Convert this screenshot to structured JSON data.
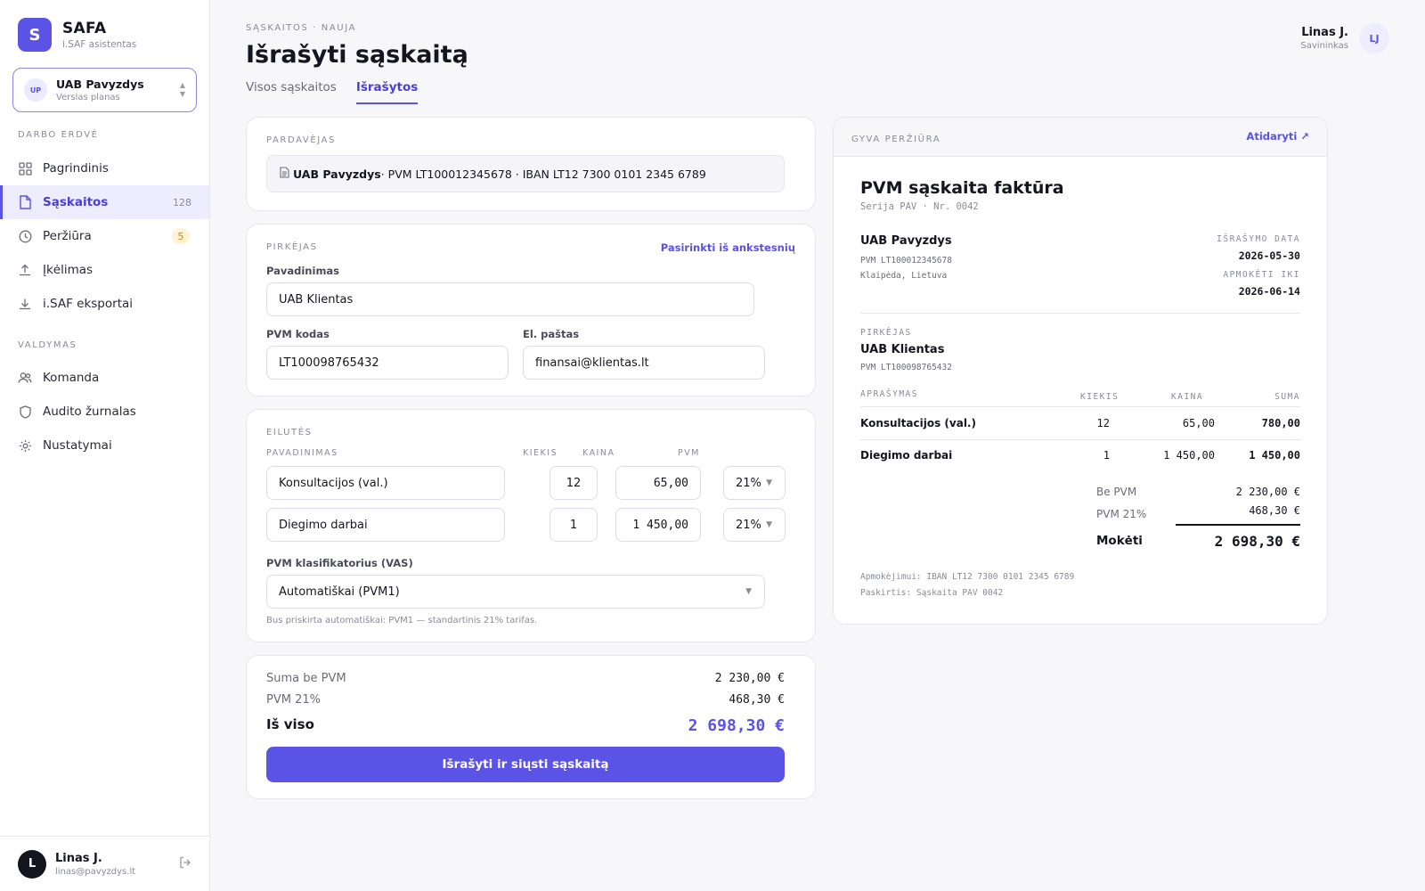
{
  "brand": {
    "logo": "S",
    "name": "SAFA",
    "sub": "i.SAF asistentas"
  },
  "workspace": {
    "avatar": "UP",
    "name": "UAB Pavyzdys",
    "plan": "Verslas planas"
  },
  "sidebar": {
    "section_workspace": "DARBO ERDVĖ",
    "section_admin": "VALDYMAS",
    "items": [
      {
        "label": "Pagrindinis",
        "icon": "grid-icon"
      },
      {
        "label": "Sąskaitos",
        "icon": "document-icon",
        "count": "128",
        "active": true
      },
      {
        "label": "Peržiūra",
        "icon": "clock-icon",
        "badge": "5"
      },
      {
        "label": "Įkėlimas",
        "icon": "upload-icon"
      },
      {
        "label": "i.SAF eksportai",
        "icon": "download-icon"
      },
      {
        "label": "Komanda",
        "icon": "users-icon"
      },
      {
        "label": "Audito žurnalas",
        "icon": "shield-icon"
      },
      {
        "label": "Nustatymai",
        "icon": "gear-icon"
      }
    ]
  },
  "footer_user": {
    "avatar": "L",
    "name": "Linas J.",
    "email": "linas@pavyzdys.lt"
  },
  "header": {
    "breadcrumb": "SĄSKAITOS · NAUJA",
    "title": "Išrašyti sąskaitą",
    "tabs": [
      "Visos sąskaitos",
      "Išrašytos"
    ],
    "active_tab": 1,
    "user_name": "Linas J.",
    "user_role": "Savininkas",
    "user_initials": "LJ"
  },
  "seller": {
    "label": "PARDAVĖJAS",
    "name": "UAB Pavyzdys",
    "details": " · PVM LT100012345678 · IBAN LT12 7300 0101 2345 6789"
  },
  "buyer": {
    "label": "PIRKĖJAS",
    "pick_link": "Pasirinkti iš ankstesnių",
    "name_label": "Pavadinimas",
    "name_value": "UAB Klientas",
    "vat_label": "PVM kodas",
    "vat_value": "LT100098765432",
    "email_label": "El. paštas",
    "email_value": "finansai@klientas.lt"
  },
  "lines": {
    "label": "EILUTĖS",
    "columns": [
      "PAVADINIMAS",
      "KIEKIS",
      "KAINA",
      "PVM"
    ],
    "rows": [
      {
        "name": "Konsultacijos (val.)",
        "qty": "12",
        "price": "65,00",
        "vat": "21%"
      },
      {
        "name": "Diegimo darbai",
        "qty": "1",
        "price": "1 450,00",
        "vat": "21%"
      }
    ],
    "classifier_label": "PVM klasifikatorius (VAS)",
    "classifier_value": "Automatiškai (PVM1)",
    "hint": "Bus priskirta automatiškai: PVM1 — standartinis 21% tarifas."
  },
  "totals": {
    "net_label": "Suma be PVM",
    "net_value": "2 230,00 €",
    "vat_label": "PVM 21%",
    "vat_value": "468,30 €",
    "total_label": "Iš viso",
    "total_value": "2 698,30 €",
    "submit": "Išrašyti ir siųsti sąskaitą"
  },
  "preview": {
    "label": "GYVA PERŽIŪRA",
    "open_link": "Atidaryti ↗",
    "title": "PVM sąskaita faktūra",
    "series": "Serija PAV · Nr. 0042",
    "seller_name": "UAB Pavyzdys",
    "seller_vat": "PVM LT100012345678",
    "seller_city": "Klaipėda, Lietuva",
    "issue_label": "IŠRAŠYMO DATA",
    "issue_date": "2026-05-30",
    "due_label": "APMOKĖTI IKI",
    "due_date": "2026-06-14",
    "buyer_label": "PIRKĖJAS",
    "buyer_name": "UAB Klientas",
    "buyer_vat": "PVM LT100098765432",
    "columns": [
      "APRAŠYMAS",
      "KIEKIS",
      "KAINA",
      "SUMA"
    ],
    "rows": [
      {
        "desc": "Konsultacijos (val.)",
        "qty": "12",
        "price": "65,00",
        "sum": "780,00"
      },
      {
        "desc": "Diegimo darbai",
        "qty": "1",
        "price": "1 450,00",
        "sum": "1 450,00"
      }
    ],
    "net_label": "Be PVM",
    "net_value": "2 230,00 €",
    "vat_label": "PVM 21%",
    "vat_value": "468,30 €",
    "pay_label": "Mokėti",
    "pay_value": "2 698,30 €",
    "note_iban": "Apmokėjimui: IBAN LT12 7300 0101 2345 6789",
    "note_purpose": "Paskirtis: Sąskaita PAV 0042"
  },
  "colors": {
    "accent": "#5b52e6",
    "badge": "#c48a10"
  }
}
